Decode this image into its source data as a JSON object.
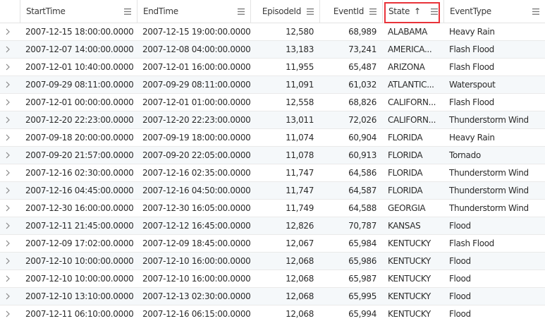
{
  "columns": {
    "start": "StartTime",
    "end": "EndTime",
    "episode": "EpisodeId",
    "event": "EventId",
    "state": "State",
    "type": "EventType"
  },
  "sort": {
    "column": "State",
    "direction": "ascending",
    "indicator": "↑"
  },
  "highlight_color": "#e8333a",
  "rows": [
    {
      "start": "2007-12-15 18:00:00.0000",
      "end": "2007-12-15 19:00:00.0000",
      "episode": "12,580",
      "event": "68,989",
      "state": "ALABAMA",
      "type": "Heavy Rain"
    },
    {
      "start": "2007-12-07 14:00:00.0000",
      "end": "2007-12-08 04:00:00.0000",
      "episode": "13,183",
      "event": "73,241",
      "state": "AMERICA...",
      "type": "Flash Flood"
    },
    {
      "start": "2007-12-01 10:40:00.0000",
      "end": "2007-12-01 16:00:00.0000",
      "episode": "11,955",
      "event": "65,487",
      "state": "ARIZONA",
      "type": "Flash Flood"
    },
    {
      "start": "2007-09-29 08:11:00.0000",
      "end": "2007-09-29 08:11:00.0000",
      "episode": "11,091",
      "event": "61,032",
      "state": "ATLANTIC...",
      "type": "Waterspout"
    },
    {
      "start": "2007-12-01 00:00:00.0000",
      "end": "2007-12-01 01:00:00.0000",
      "episode": "12,558",
      "event": "68,826",
      "state": "CALIFORN...",
      "type": "Flash Flood"
    },
    {
      "start": "2007-12-20 22:23:00.0000",
      "end": "2007-12-20 22:23:00.0000",
      "episode": "13,011",
      "event": "72,026",
      "state": "CALIFORN...",
      "type": "Thunderstorm Wind"
    },
    {
      "start": "2007-09-18 20:00:00.0000",
      "end": "2007-09-19 18:00:00.0000",
      "episode": "11,074",
      "event": "60,904",
      "state": "FLORIDA",
      "type": "Heavy Rain"
    },
    {
      "start": "2007-09-20 21:57:00.0000",
      "end": "2007-09-20 22:05:00.0000",
      "episode": "11,078",
      "event": "60,913",
      "state": "FLORIDA",
      "type": "Tornado"
    },
    {
      "start": "2007-12-16 02:30:00.0000",
      "end": "2007-12-16 02:35:00.0000",
      "episode": "11,747",
      "event": "64,586",
      "state": "FLORIDA",
      "type": "Thunderstorm Wind"
    },
    {
      "start": "2007-12-16 04:45:00.0000",
      "end": "2007-12-16 04:50:00.0000",
      "episode": "11,747",
      "event": "64,587",
      "state": "FLORIDA",
      "type": "Thunderstorm Wind"
    },
    {
      "start": "2007-12-30 16:00:00.0000",
      "end": "2007-12-30 16:05:00.0000",
      "episode": "11,749",
      "event": "64,588",
      "state": "GEORGIA",
      "type": "Thunderstorm Wind"
    },
    {
      "start": "2007-12-11 21:45:00.0000",
      "end": "2007-12-12 16:45:00.0000",
      "episode": "12,826",
      "event": "70,787",
      "state": "KANSAS",
      "type": "Flood"
    },
    {
      "start": "2007-12-09 17:02:00.0000",
      "end": "2007-12-09 18:45:00.0000",
      "episode": "12,067",
      "event": "65,984",
      "state": "KENTUCKY",
      "type": "Flash Flood"
    },
    {
      "start": "2007-12-10 10:00:00.0000",
      "end": "2007-12-10 16:00:00.0000",
      "episode": "12,068",
      "event": "65,986",
      "state": "KENTUCKY",
      "type": "Flood"
    },
    {
      "start": "2007-12-10 10:00:00.0000",
      "end": "2007-12-10 16:00:00.0000",
      "episode": "12,068",
      "event": "65,987",
      "state": "KENTUCKY",
      "type": "Flood"
    },
    {
      "start": "2007-12-10 13:10:00.0000",
      "end": "2007-12-13 02:30:00.0000",
      "episode": "12,068",
      "event": "65,995",
      "state": "KENTUCKY",
      "type": "Flood"
    },
    {
      "start": "2007-12-11 06:10:00.0000",
      "end": "2007-12-16 06:15:00.0000",
      "episode": "12,068",
      "event": "65,994",
      "state": "KENTUCKY",
      "type": "Flood"
    }
  ]
}
